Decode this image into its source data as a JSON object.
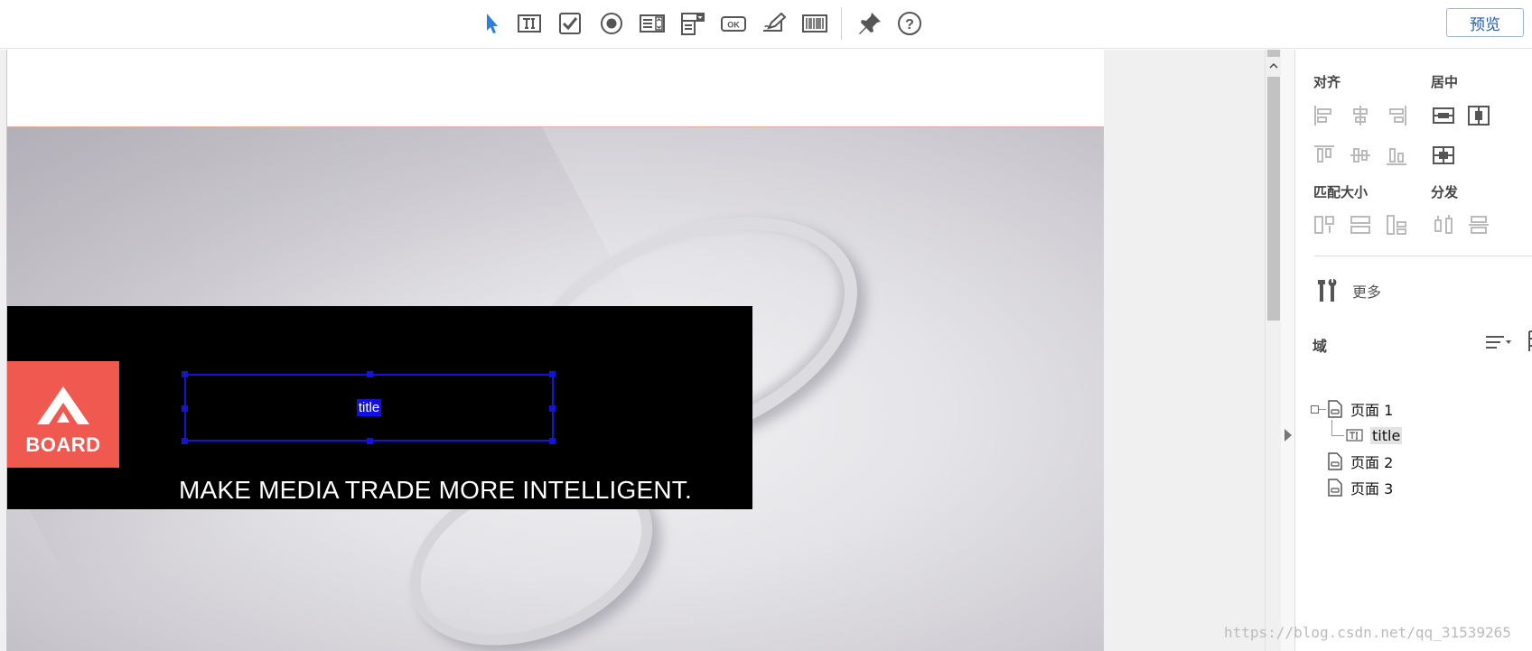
{
  "toolbar": {
    "tools": [
      {
        "name": "select-tool",
        "icon": "cursor-arrow-icon"
      },
      {
        "name": "text-field-tool",
        "icon": "text-field-icon"
      },
      {
        "name": "checkbox-tool",
        "icon": "checkbox-icon"
      },
      {
        "name": "radio-button-tool",
        "icon": "radio-button-icon"
      },
      {
        "name": "list-box-tool",
        "icon": "list-box-icon"
      },
      {
        "name": "combo-box-tool",
        "icon": "combo-box-icon"
      },
      {
        "name": "button-tool",
        "icon": "ok-button-icon",
        "text": "OK"
      },
      {
        "name": "signature-tool",
        "icon": "signature-pen-icon"
      },
      {
        "name": "barcode-tool",
        "icon": "barcode-icon"
      },
      {
        "name": "pin-tool",
        "icon": "pin-icon"
      },
      {
        "name": "help-tool",
        "icon": "help-circle-icon",
        "text": "?"
      }
    ],
    "preview_label": "预览"
  },
  "canvas": {
    "brand_text": "BOARD",
    "title_field_label": "title",
    "tagline": "MAKE MEDIA TRADE MORE INTELLIGENT.",
    "brand_color": "#f0594f",
    "selection_color": "#1414d8"
  },
  "panel": {
    "align_label": "对齐",
    "center_label": "居中",
    "match_size_label": "匹配大小",
    "distribute_label": "分发",
    "more_label": "更多",
    "domain_label": "域",
    "tree": [
      {
        "label": "页面 1",
        "children": [
          {
            "label": "title",
            "selected": true
          }
        ]
      },
      {
        "label": "页面 2"
      },
      {
        "label": "页面 3"
      }
    ]
  },
  "watermark": "https://blog.csdn.net/qq_31539265"
}
